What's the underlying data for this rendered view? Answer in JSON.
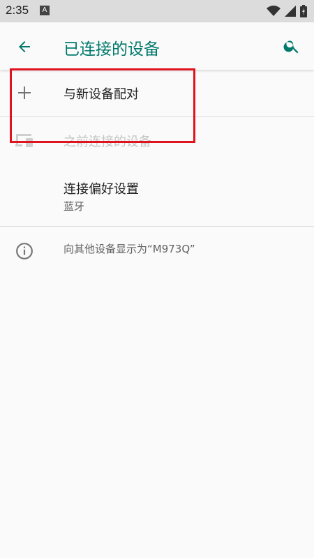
{
  "status": {
    "time": "2:35",
    "notif_letter": "A"
  },
  "toolbar": {
    "title": "已连接的设备",
    "back_icon": "arrow-back-icon",
    "search_icon": "search-icon"
  },
  "items": {
    "pair": {
      "label": "与新设备配对",
      "icon": "plus-icon"
    },
    "previous": {
      "label": "之前连接的设备",
      "icon": "devices-icon"
    },
    "preferences": {
      "label": "连接偏好设置",
      "summary": "蓝牙"
    },
    "visible_as": {
      "label": "向其他设备显示为“M973Q”",
      "icon": "info-icon"
    }
  },
  "colors": {
    "accent": "#00796b",
    "highlight": "#e0141e"
  }
}
